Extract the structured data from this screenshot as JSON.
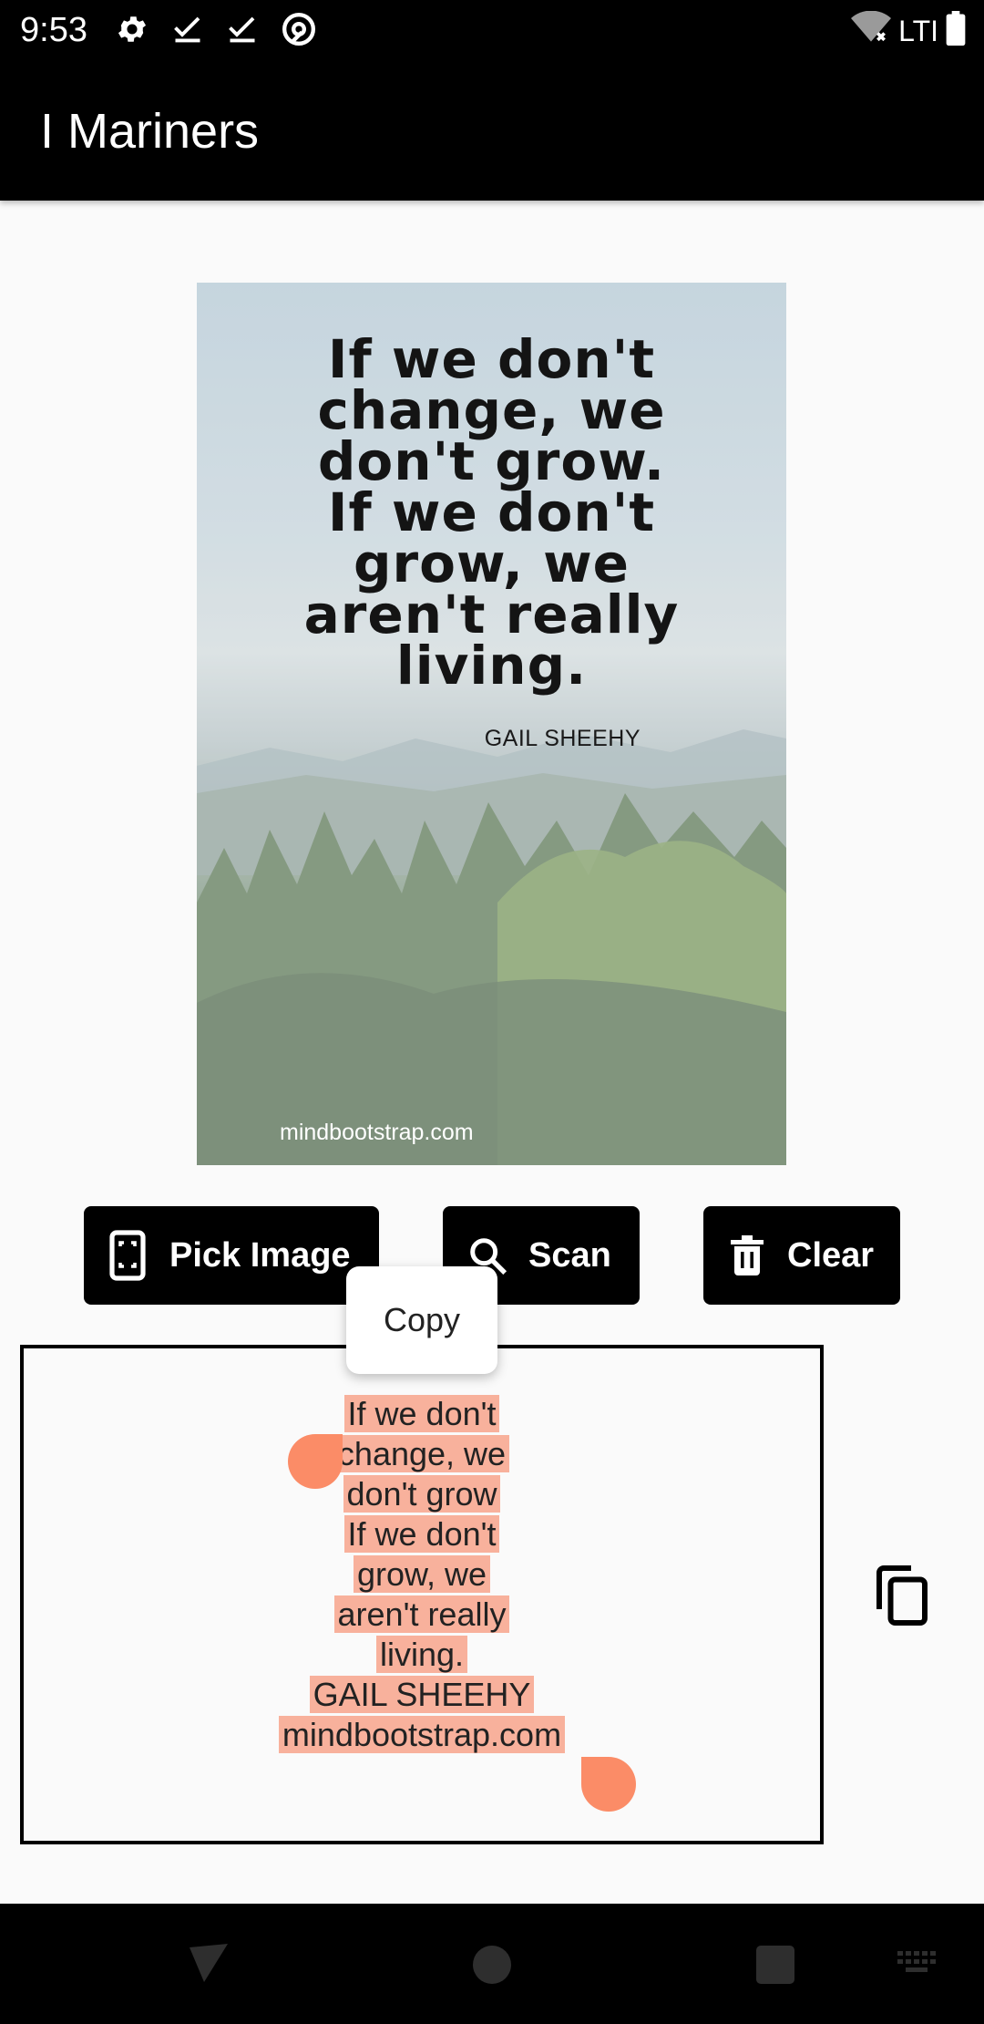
{
  "status_bar": {
    "time": "9:53",
    "network_label": "LTI",
    "icons": [
      "gear-icon",
      "checkmark-icon",
      "checkmark-icon",
      "at-sign-icon",
      "wifi-off-icon",
      "battery-icon"
    ]
  },
  "app_bar": {
    "title": "I Mariners"
  },
  "image": {
    "quote_lines": [
      "If we don't",
      "change, we",
      "don't grow.",
      "If we don't",
      "grow, we",
      "aren't really",
      "living."
    ],
    "author": "GAIL SHEEHY",
    "site": "mindbootstrap.com"
  },
  "buttons": {
    "pick_image": "Pick Image",
    "scan": "Scan",
    "clear": "Clear"
  },
  "context_menu": {
    "copy": "Copy"
  },
  "result": {
    "lines": [
      "If we don't",
      "change, we",
      "don't grow",
      "If we don't",
      "grow, we",
      "aren't really",
      "living.",
      "GAIL SHEEHY",
      "mindbootstrap.com"
    ]
  },
  "colors": {
    "selection": "#f8b19c",
    "handle": "#fb8c67",
    "bar": "#000000"
  }
}
